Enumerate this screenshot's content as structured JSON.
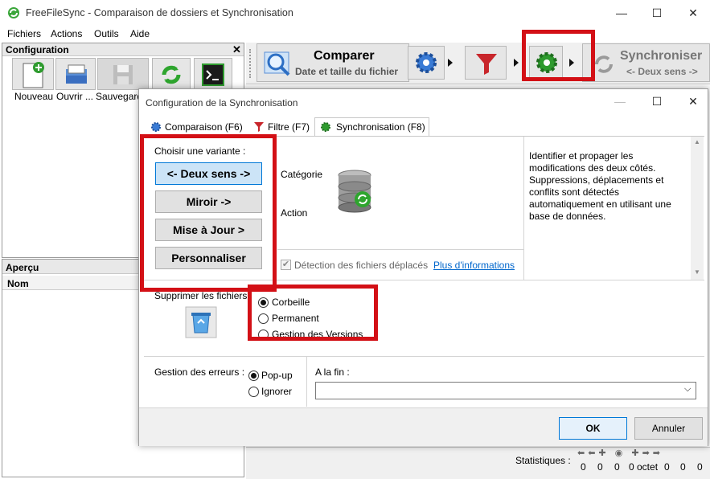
{
  "window": {
    "title": "FreeFileSync - Comparaison de dossiers et Synchronisation"
  },
  "menu": [
    "Fichiers",
    "Actions",
    "Outils",
    "Aide"
  ],
  "config_panel": {
    "title": "Configuration",
    "buttons": [
      "Nouveau",
      "Ouvrir ...",
      "Sauvegarder"
    ]
  },
  "overview_panel": {
    "title": "Aperçu",
    "column": "Nom"
  },
  "toolbar": {
    "compare_title": "Comparer",
    "compare_sub": "Date et taille du fichier",
    "sync_title": "Synchroniser",
    "sync_sub": "<- Deux sens ->"
  },
  "dialog": {
    "title": "Configuration de la Synchronisation",
    "tabs": [
      "Comparaison (F6)",
      "Filtre (F7)",
      "Synchronisation (F8)"
    ],
    "variant_label": "Choisir une variante :",
    "variants": [
      "<- Deux sens ->",
      "Miroir ->",
      "Mise à Jour >",
      "Personnaliser"
    ],
    "category_label": "Catégorie",
    "action_label": "Action",
    "description": [
      "Identifier et propager les",
      "modifications des deux côtés.",
      "Suppressions, déplacements et",
      "conflits sont détectés",
      "automatiquement en utilisant une",
      "base de données."
    ],
    "detect_moved": "Détection des fichiers déplacés",
    "more_info": "Plus d'informations",
    "delete_label": "Supprimer les fichiers",
    "delete_options": [
      "Corbeille",
      "Permanent",
      "Gestion des Versions"
    ],
    "errors_label": "Gestion des erreurs :",
    "error_options": [
      "Pop-up",
      "Ignorer"
    ],
    "on_finish_label": "A la fin :",
    "ok": "OK",
    "cancel": "Annuler"
  },
  "status": {
    "label": "Statistiques :",
    "counts": [
      "0",
      "0",
      "0",
      "0 octet",
      "0",
      "0",
      "0"
    ]
  },
  "colors": {
    "highlight": "#d31016",
    "accent": "#0078d7"
  }
}
